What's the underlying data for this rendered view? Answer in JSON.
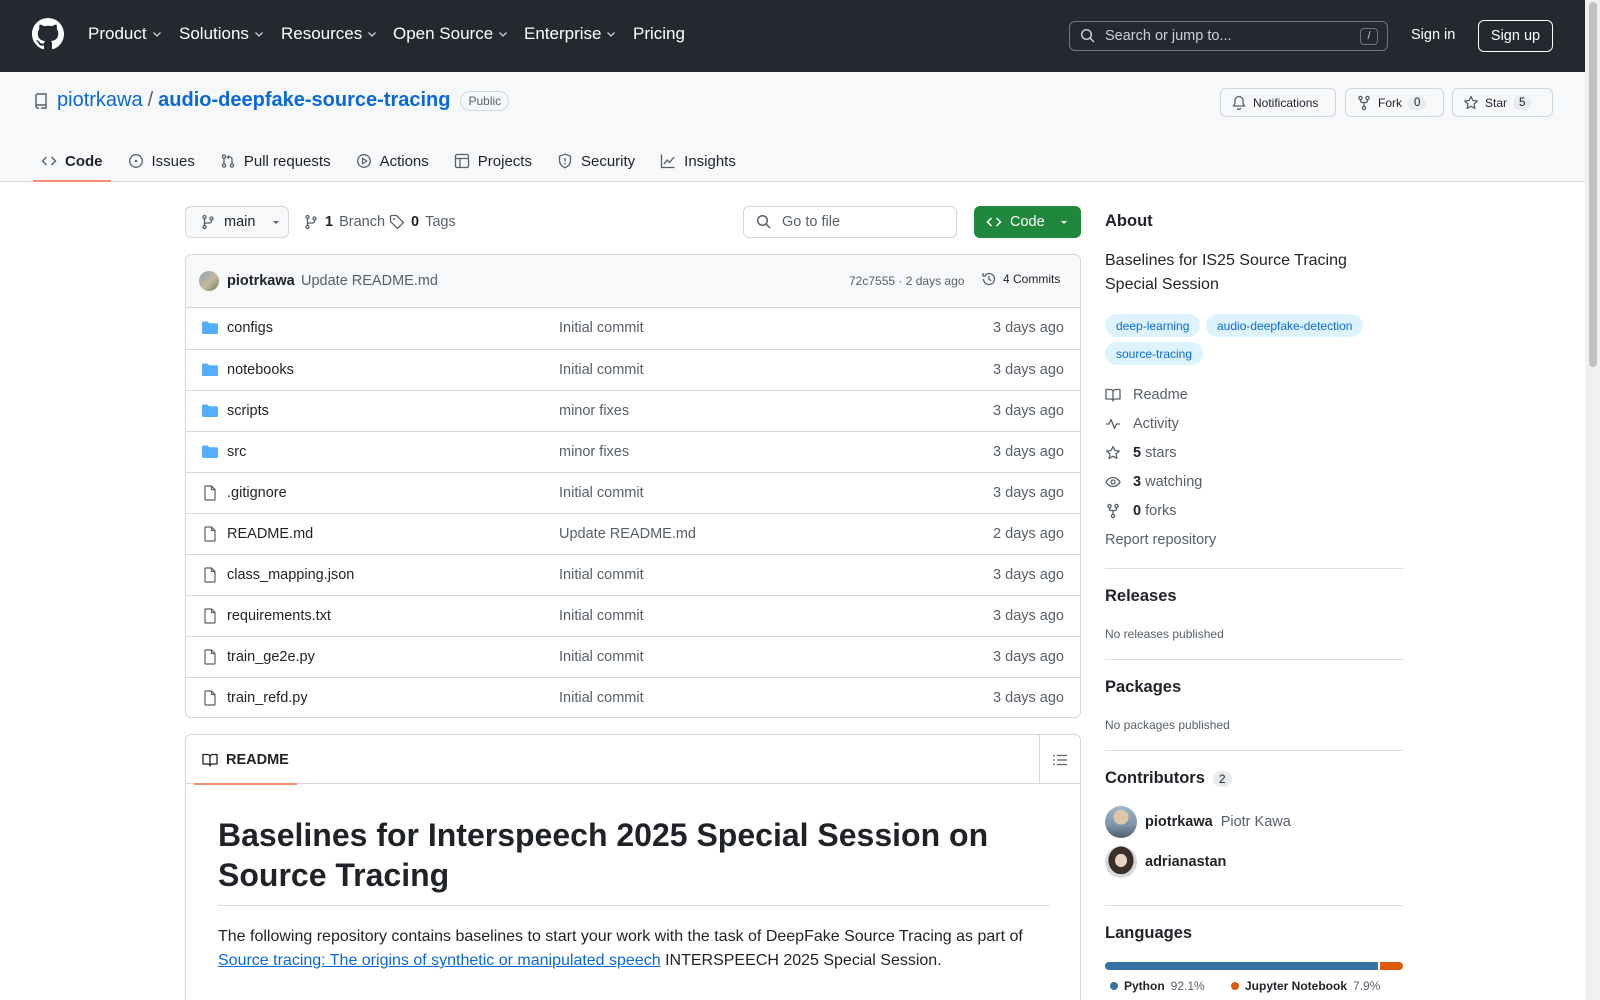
{
  "topnav": {
    "items": [
      {
        "label": "Product",
        "dropdown": true
      },
      {
        "label": "Solutions",
        "dropdown": true
      },
      {
        "label": "Resources",
        "dropdown": true
      },
      {
        "label": "Open Source",
        "dropdown": true
      },
      {
        "label": "Enterprise",
        "dropdown": true
      },
      {
        "label": "Pricing",
        "dropdown": false
      }
    ],
    "search_placeholder": "Search or jump to...",
    "search_shortcut": "/",
    "signin": "Sign in",
    "signup": "Sign up"
  },
  "repo": {
    "owner": "piotrkawa",
    "separator": "/",
    "name": "audio-deepfake-source-tracing",
    "visibility": "Public",
    "notifications_label": "Notifications",
    "fork_label": "Fork",
    "fork_count": "0",
    "star_label": "Star",
    "star_count": "5"
  },
  "tabs": [
    {
      "label": "Code",
      "icon": "code-icon",
      "active": true
    },
    {
      "label": "Issues",
      "icon": "issue-icon"
    },
    {
      "label": "Pull requests",
      "icon": "pull-request-icon"
    },
    {
      "label": "Actions",
      "icon": "play-icon"
    },
    {
      "label": "Projects",
      "icon": "table-icon"
    },
    {
      "label": "Security",
      "icon": "shield-icon"
    },
    {
      "label": "Insights",
      "icon": "graph-icon"
    }
  ],
  "browser": {
    "branch": "main",
    "branch_count": "1",
    "branch_label": "Branch",
    "tag_count": "0",
    "tag_label": "Tags",
    "goto_placeholder": "Go to file",
    "code_button": "Code"
  },
  "latest_commit": {
    "author": "piotrkawa",
    "message": "Update README.md",
    "sha_time": "72c7555 · 2 days ago",
    "commits": "4 Commits"
  },
  "files": [
    {
      "name": "configs",
      "type": "dir",
      "message": "Initial commit",
      "date": "3 days ago"
    },
    {
      "name": "notebooks",
      "type": "dir",
      "message": "Initial commit",
      "date": "3 days ago"
    },
    {
      "name": "scripts",
      "type": "dir",
      "message": "minor fixes",
      "date": "3 days ago"
    },
    {
      "name": "src",
      "type": "dir",
      "message": "minor fixes",
      "date": "3 days ago"
    },
    {
      "name": ".gitignore",
      "type": "file",
      "message": "Initial commit",
      "date": "3 days ago"
    },
    {
      "name": "README.md",
      "type": "file",
      "message": "Update README.md",
      "date": "2 days ago"
    },
    {
      "name": "class_mapping.json",
      "type": "file",
      "message": "Initial commit",
      "date": "3 days ago"
    },
    {
      "name": "requirements.txt",
      "type": "file",
      "message": "Initial commit",
      "date": "3 days ago"
    },
    {
      "name": "train_ge2e.py",
      "type": "file",
      "message": "Initial commit",
      "date": "3 days ago"
    },
    {
      "name": "train_refd.py",
      "type": "file",
      "message": "Initial commit",
      "date": "3 days ago"
    }
  ],
  "readme": {
    "tab_label": "README",
    "heading": "Baselines for Interspeech 2025 Special Session on Source Tracing",
    "para_before": "The following repository contains baselines to start your work with the task of DeepFake Source Tracing as part of ",
    "para_link": "Source tracing: The origins of synthetic or manipulated speech",
    "para_after": " INTERSPEECH 2025 Special Session."
  },
  "about": {
    "heading": "About",
    "description": "Baselines for IS25 Source Tracing Special Session",
    "topics": [
      "deep-learning",
      "audio-deepfake-detection",
      "source-tracing"
    ],
    "readme": "Readme",
    "activity": "Activity",
    "stars_count": "5",
    "stars_label": "stars",
    "watching_count": "3",
    "watching_label": "watching",
    "forks_count": "0",
    "forks_label": "forks",
    "report": "Report repository"
  },
  "releases": {
    "heading": "Releases",
    "empty": "No releases published"
  },
  "packages": {
    "heading": "Packages",
    "empty": "No packages published"
  },
  "contributors": {
    "heading": "Contributors",
    "count": "2",
    "people": [
      {
        "login": "piotrkawa",
        "name": "Piotr Kawa"
      },
      {
        "login": "adrianastan",
        "name": ""
      }
    ]
  },
  "languages": {
    "heading": "Languages",
    "items": [
      {
        "name": "Python",
        "percent": "92.1%",
        "value": 92.1,
        "color": "#3572A5"
      },
      {
        "name": "Jupyter Notebook",
        "percent": "7.9%",
        "value": 7.9,
        "color": "#DA5B0B"
      }
    ]
  }
}
